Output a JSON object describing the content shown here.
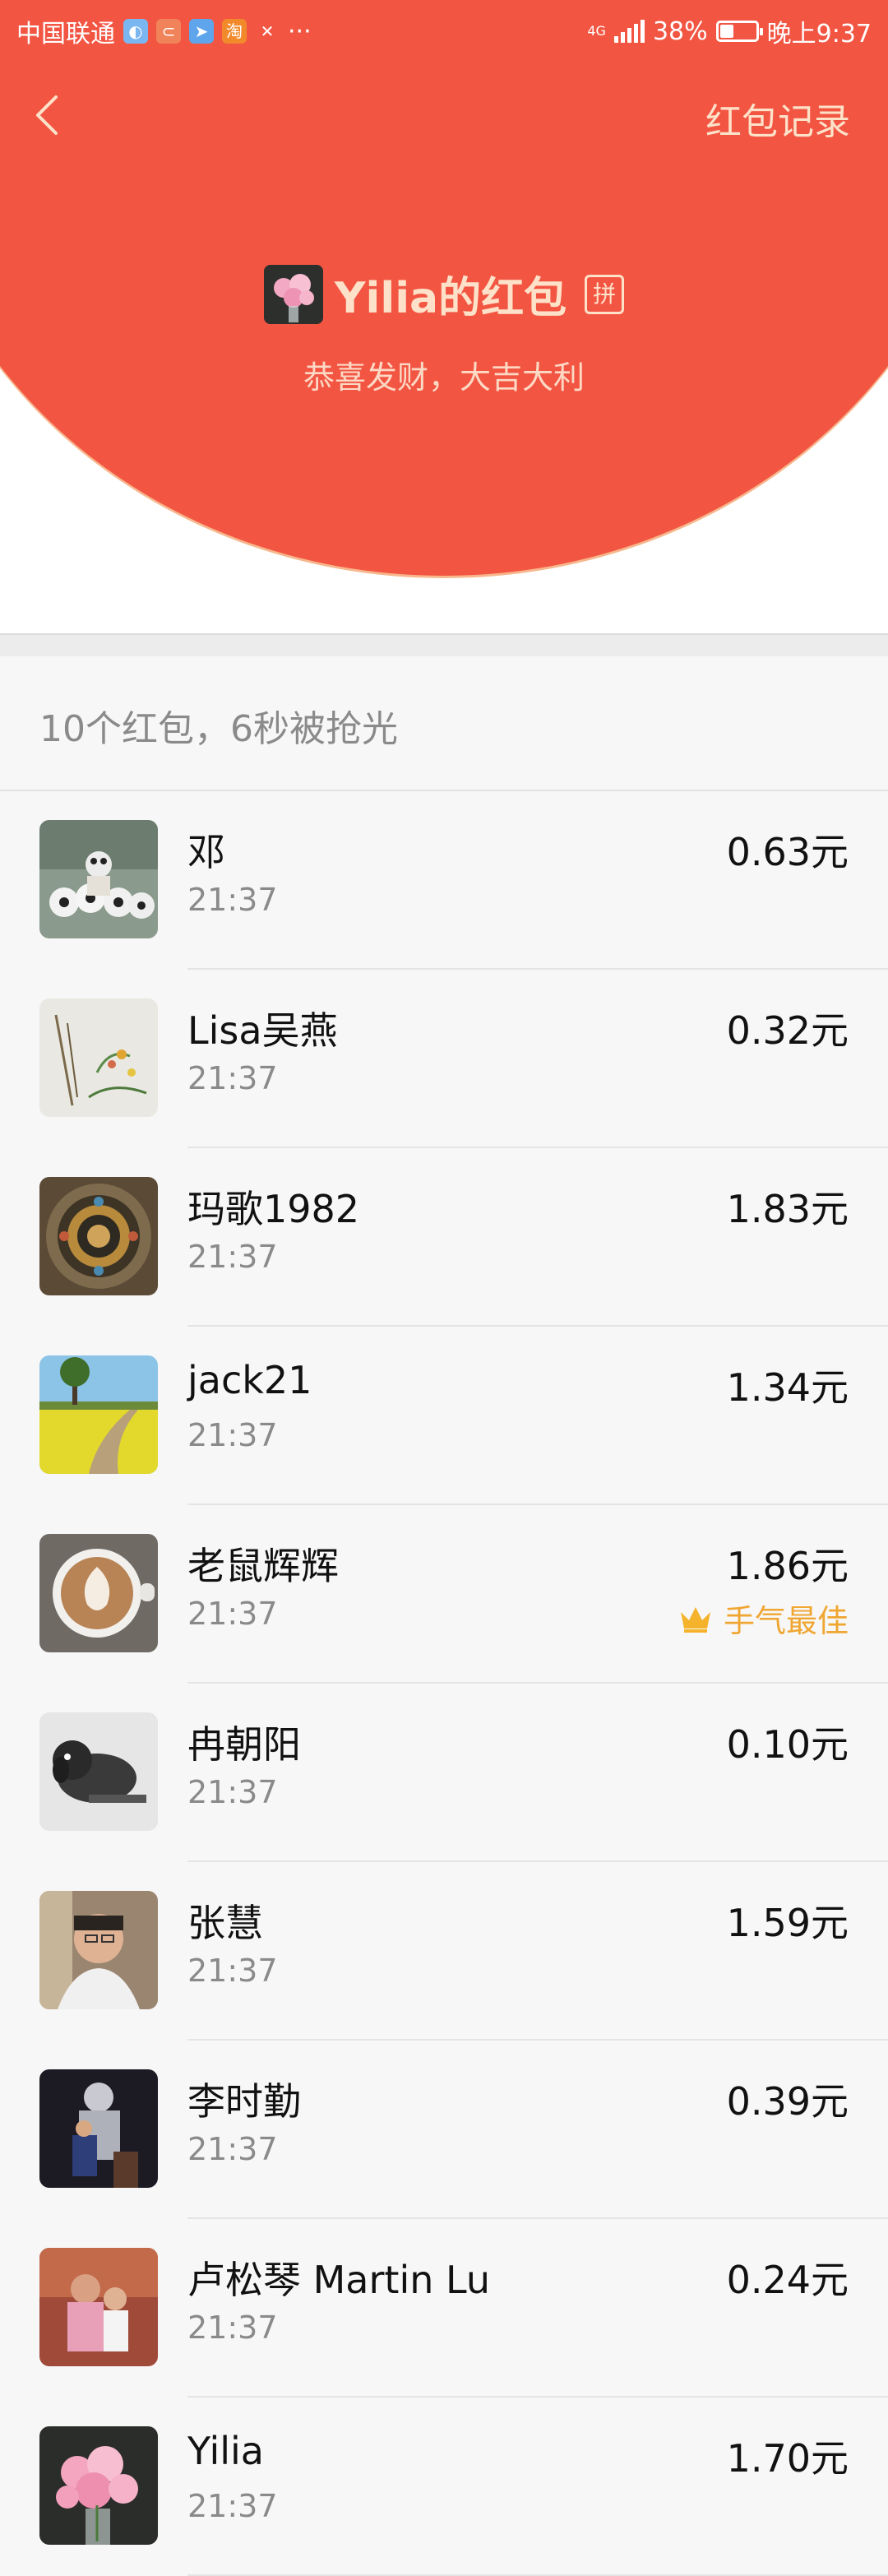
{
  "status_bar": {
    "carrier": "中国联通",
    "icons": [
      "qq-icon",
      "chat-icon",
      "send-icon",
      "taobao-icon",
      "app-icon"
    ],
    "more": "···",
    "network": "4G",
    "battery_text": "38%",
    "battery_level": 0.38,
    "time": "晚上9:37"
  },
  "header": {
    "back_icon": "chevron-left-icon",
    "record_link": "红包记录",
    "sender_name": "Yilia的红包",
    "pin_label": "拼",
    "greeting": "恭喜发财，大吉大利",
    "accent_color": "#f35543"
  },
  "summary": "10个红包，6秒被抢光",
  "records": [
    {
      "name": "邓",
      "time": "21:37",
      "amount": "0.63元",
      "avatar": "pandas"
    },
    {
      "name": "Lisa吴燕",
      "time": "21:37",
      "amount": "0.32元",
      "avatar": "painting"
    },
    {
      "name": "玛歌1982",
      "time": "21:37",
      "amount": "1.83元",
      "avatar": "mandala"
    },
    {
      "name": "jack21",
      "time": "21:37",
      "amount": "1.34元",
      "avatar": "field"
    },
    {
      "name": "老鼠辉辉",
      "time": "21:37",
      "amount": "1.86元",
      "avatar": "coffee",
      "best": "手气最佳"
    },
    {
      "name": "冉朝阳",
      "time": "21:37",
      "amount": "0.10元",
      "avatar": "dog"
    },
    {
      "name": "张慧",
      "time": "21:37",
      "amount": "1.59元",
      "avatar": "man"
    },
    {
      "name": "李时勤",
      "time": "21:37",
      "amount": "0.39元",
      "avatar": "statue"
    },
    {
      "name": "卢松琴 Martin Lu",
      "time": "21:37",
      "amount": "0.24元",
      "avatar": "family"
    },
    {
      "name": "Yilia",
      "time": "21:37",
      "amount": "1.70元",
      "avatar": "flowers"
    }
  ]
}
